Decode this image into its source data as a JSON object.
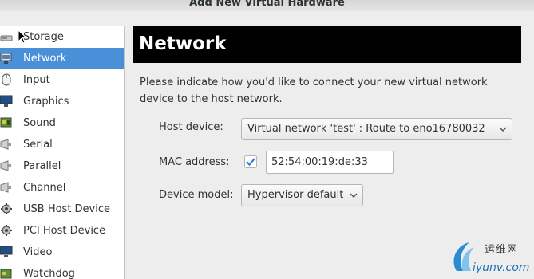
{
  "window": {
    "title": "Add New Virtual Hardware"
  },
  "sidebar": {
    "items": [
      {
        "label": "Storage",
        "icon": "storage-icon",
        "selected": false
      },
      {
        "label": "Network",
        "icon": "network-icon",
        "selected": true
      },
      {
        "label": "Input",
        "icon": "mouse-icon",
        "selected": false
      },
      {
        "label": "Graphics",
        "icon": "monitor-icon",
        "selected": false
      },
      {
        "label": "Sound",
        "icon": "sound-card-icon",
        "selected": false
      },
      {
        "label": "Serial",
        "icon": "serial-port-icon",
        "selected": false
      },
      {
        "label": "Parallel",
        "icon": "parallel-port-icon",
        "selected": false
      },
      {
        "label": "Channel",
        "icon": "channel-icon",
        "selected": false
      },
      {
        "label": "USB Host Device",
        "icon": "usb-device-icon",
        "selected": false
      },
      {
        "label": "PCI Host Device",
        "icon": "pci-device-icon",
        "selected": false
      },
      {
        "label": "Video",
        "icon": "video-monitor-icon",
        "selected": false
      },
      {
        "label": "Watchdog",
        "icon": "watchdog-icon",
        "selected": false
      }
    ]
  },
  "main": {
    "header_title": "Network",
    "description": "Please indicate how you'd like to connect your new virtual network device to the host network.",
    "host_device": {
      "label": "Host device:",
      "value": "Virtual network 'test' : Route to eno16780032"
    },
    "mac_address": {
      "label": "MAC address:",
      "checked": true,
      "value": "52:54:00:19:de:33"
    },
    "device_model": {
      "label": "Device model:",
      "value": "Hypervisor default"
    }
  },
  "watermark": {
    "brand": "运维网",
    "url": "iyunv.com"
  },
  "colors": {
    "selection": "#4a90d9",
    "header_bg": "#000000",
    "window_bg": "#ededed"
  }
}
